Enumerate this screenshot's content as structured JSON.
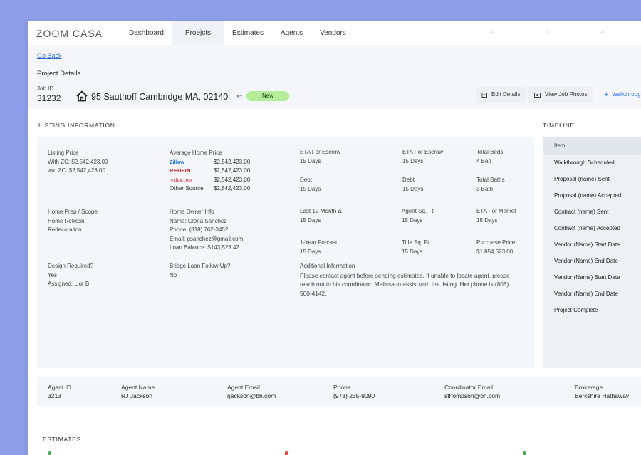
{
  "app": {
    "logo": "ZOOM CASA"
  },
  "nav": {
    "items": [
      {
        "label": "Dashboard"
      },
      {
        "label": "Proejcts"
      },
      {
        "label": "Estimates"
      },
      {
        "label": "Agents"
      },
      {
        "label": "Vendors"
      }
    ]
  },
  "header": {
    "go_back": "Go Back",
    "title": "Project Details",
    "job_id_label": "Job ID",
    "job_id": "31232",
    "address": "95 Sauthoff Cambridge MA, 02140",
    "status_badge": "New",
    "edit_details": "Edit Details",
    "view_job_photos": "View Job Photos",
    "walkthrough": "Walkthrough"
  },
  "listing": {
    "section_title": "LISTING INFORMATION",
    "listing_price_label": "Listing Price",
    "with_zc": "With ZC:   $2,542,423.00",
    "wo_zc": "w/o ZC:   $2,542,423.00",
    "avg_home_price_label": "Average Home Price",
    "sources": [
      {
        "name": "Zillow",
        "value": "$2,542,423.00"
      },
      {
        "name": "REDFIN",
        "value": "$2,542,423.00"
      },
      {
        "name": "realtor.com",
        "value": "$2,542,423.00"
      },
      {
        "name": "Other Source",
        "value": "$2,542,423.00"
      }
    ],
    "eta_escrow_1": {
      "label": "ETA For Escrow",
      "value": "15 Days"
    },
    "eta_escrow_2": {
      "label": "ETA For Escrow",
      "value": "15 Days"
    },
    "total_beds": {
      "label": "Total Beds",
      "value": "4 Bed"
    },
    "debt_1": {
      "label": "Debt",
      "value": "15 Days"
    },
    "debt_2": {
      "label": "Debt",
      "value": "15 Days"
    },
    "total_baths": {
      "label": "Total Baths",
      "value": "3 Bath"
    },
    "home_prep": {
      "label": "Home Prep / Scope",
      "line1": "Home Refresh",
      "line2": "Redecoration"
    },
    "owner": {
      "label": "Home Owner Info",
      "name": "Name: Gloria Sanchez",
      "phone": "Phone: (818) 762-3452",
      "email": "Email: gsanchez@gmail.com",
      "loan": "Loan Balance: $143,523.42"
    },
    "last_12": {
      "label": "Last 12-Month Δ",
      "value": "15 Days"
    },
    "agent_sqft": {
      "label": "Agent Sq. Ft.",
      "value": "15 Days"
    },
    "eta_market": {
      "label": "ETA For Market",
      "value": "15 Days"
    },
    "one_year": {
      "label": "1-Year Forcast",
      "value": "15 Days"
    },
    "title_sqft": {
      "label": "Title Sq. Ft.",
      "value": "15 Days"
    },
    "purchase_price": {
      "label": "Purchase Price",
      "value": "$1,854,523.00"
    },
    "design": {
      "label": "Design Required?",
      "value": "Yes",
      "assigned": "Assigned: Lior B."
    },
    "bridge": {
      "label": "Bridge Loan Follow Up?",
      "value": "No"
    },
    "additional": {
      "label": "Additional Information",
      "text": "Please contact agent before sending estimates. If unable to locate agent, please reach out to his coordinator, Melissa to assist with the listing. Her phone is (805) 500-4142."
    }
  },
  "timeline": {
    "section_title": "TIMELINE",
    "header": "Item",
    "items": [
      "Walkthrough Scheduled",
      "Proposal (name) Sent",
      "Proposal (name) Accepted",
      "Contract (name) Sent",
      "Contract (name) Accepted",
      "Vendor (Name) Start Date",
      "Vendor (Name) End Date",
      "Vendor (Name) Start Date",
      "Vendor (Name) End Date",
      "Project Complete"
    ]
  },
  "agent": {
    "id_label": "Agent ID",
    "id": "3213",
    "name_label": "Agent Name",
    "name": "RJ Jackson",
    "email_label": "Agent Email",
    "email": "rjackson@bh.com",
    "phone_label": "Phone",
    "phone": "(973) 235-9090",
    "coord_label": "Coordinator Email",
    "coord": "sthompson@bh.com",
    "brokerage_label": "Brokerage",
    "brokerage": "Berkshire Hathaway"
  },
  "estimates": {
    "section_title": "ESTIMATES"
  },
  "colors": {
    "background": "#8f9ee9",
    "badge": "#b4ec9a",
    "link": "#2a6ad8"
  },
  "icons": [
    "house-icon",
    "link-icon",
    "edit-icon",
    "photos-icon",
    "plus-icon",
    "sparkle-icon"
  ]
}
